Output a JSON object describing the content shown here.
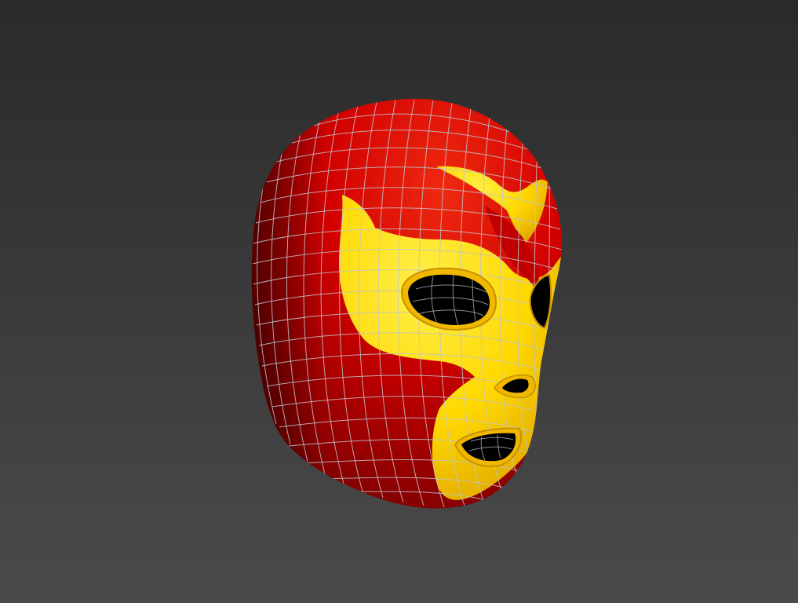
{
  "viewport": {
    "background_top": "#2a2a2a",
    "background_bottom": "#4b4b4b"
  },
  "model": {
    "object": "luchador-mask",
    "display_mode": "smooth-shaded-with-wireframe",
    "colors": {
      "base": "#d10000",
      "base_shadow": "#7a0000",
      "base_highlight": "#f02a10",
      "accent": "#ffd800",
      "accent_shadow": "#d59600",
      "wire": "#bfc4cc",
      "opening": "#000000"
    }
  }
}
